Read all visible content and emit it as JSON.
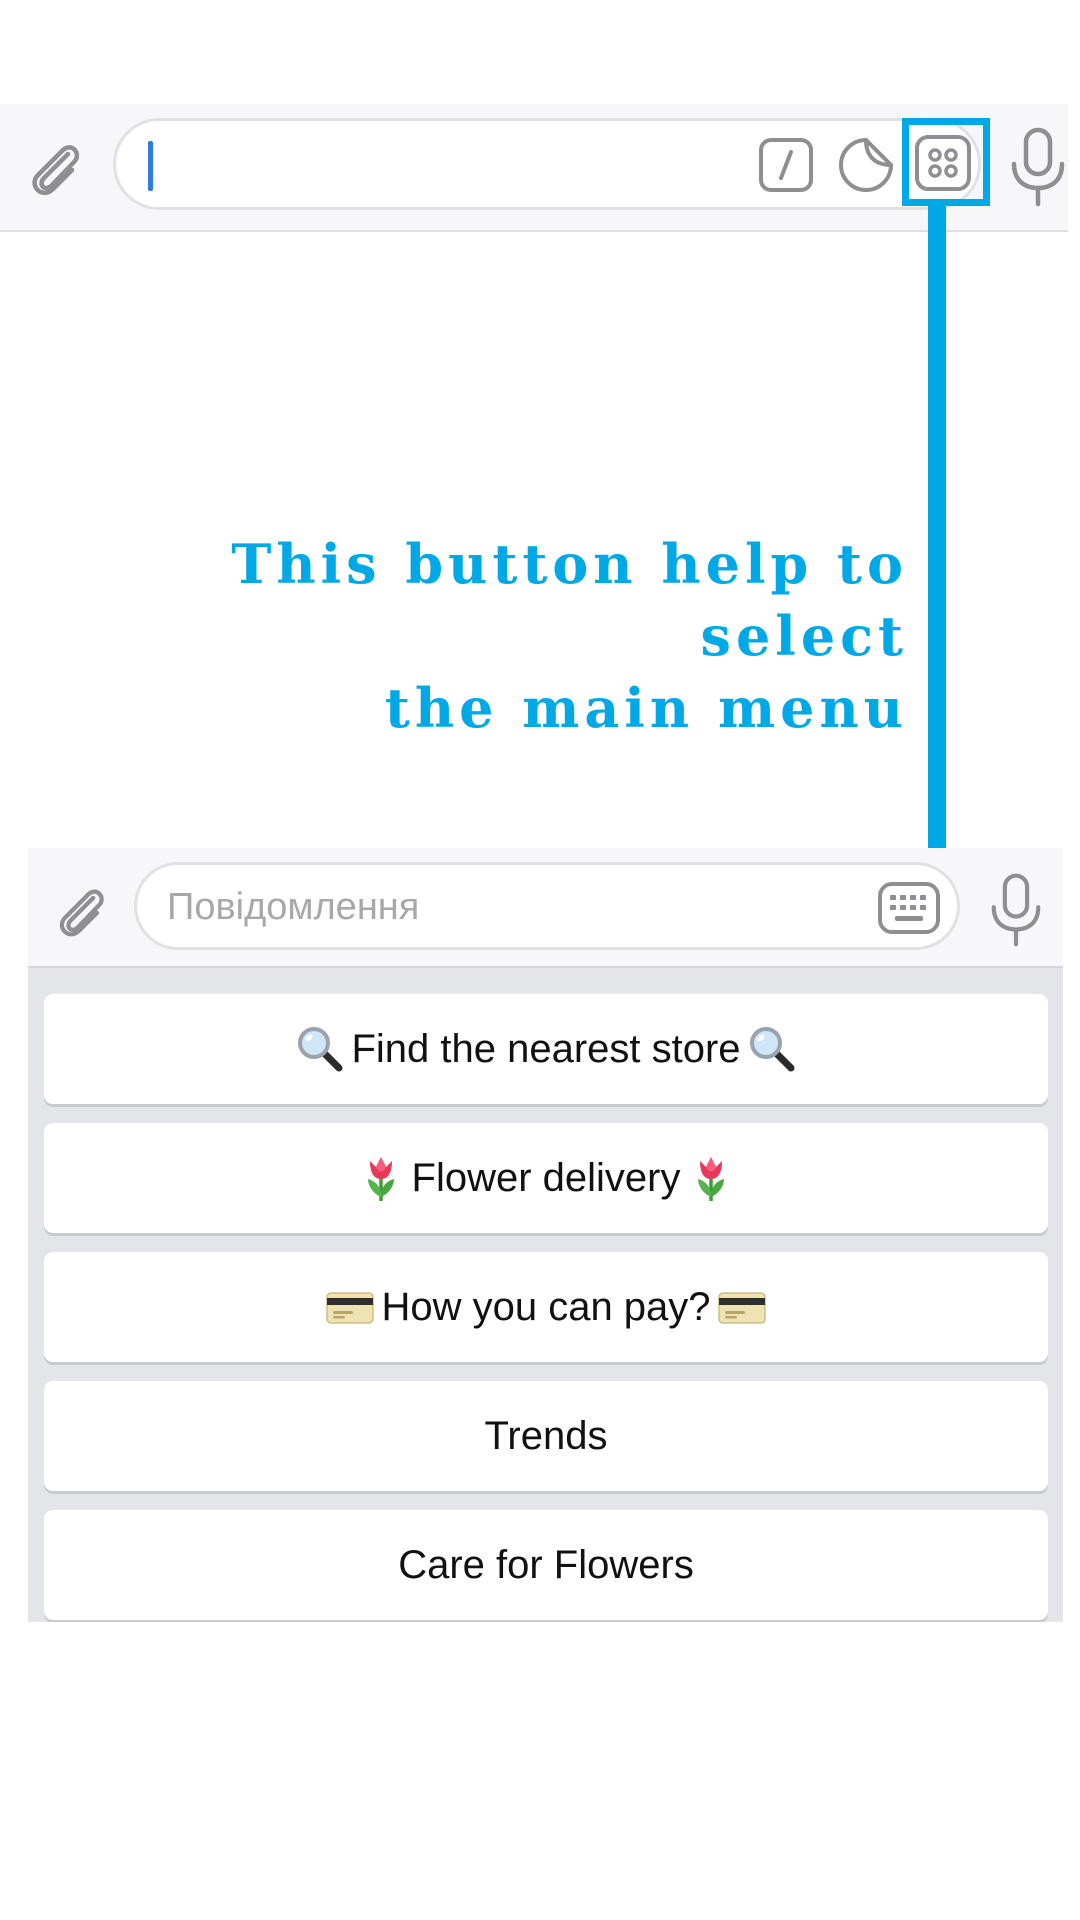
{
  "top_input": {
    "attach_icon": "paperclip-icon",
    "field_value": "",
    "command_icon": "slash-command-icon",
    "sticker_icon": "sticker-icon",
    "menu_icon": "bot-menu-icon",
    "mic_icon": "microphone-icon"
  },
  "annotation": {
    "line1": "This button help to select",
    "line2": "the main menu",
    "color": "#00a8e6"
  },
  "bottom_input": {
    "placeholder": "Повідомлення",
    "attach_icon": "paperclip-icon",
    "keyboard_icon": "keyboard-icon",
    "mic_icon": "microphone-icon"
  },
  "menu": {
    "items": [
      {
        "label": "Find the nearest store",
        "icon": "magnifier-icon"
      },
      {
        "label": "Flower delivery",
        "icon": "tulip-icon"
      },
      {
        "label": "How you can pay?",
        "icon": "credit-card-icon"
      },
      {
        "label": "Trends"
      },
      {
        "label": "Care for Flowers"
      }
    ]
  }
}
